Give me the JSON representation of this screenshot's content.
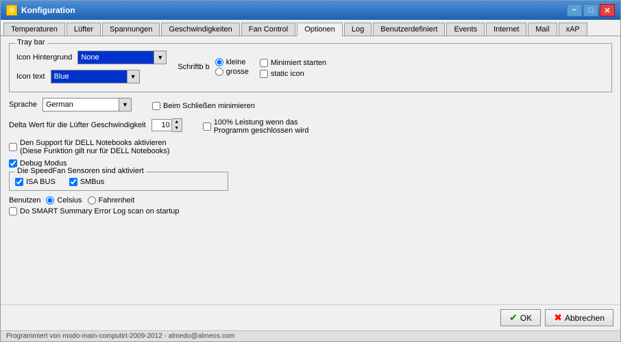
{
  "window": {
    "title": "Konfiguration",
    "icon": "⚙"
  },
  "titlebar": {
    "minimize": "−",
    "restore": "□",
    "close": "✕"
  },
  "tabs": [
    {
      "label": "Temperaturen",
      "active": false
    },
    {
      "label": "Lüfter",
      "active": false
    },
    {
      "label": "Spannungen",
      "active": false
    },
    {
      "label": "Geschwindigkeiten",
      "active": false
    },
    {
      "label": "Fan Control",
      "active": false
    },
    {
      "label": "Optionen",
      "active": true
    },
    {
      "label": "Log",
      "active": false
    },
    {
      "label": "Benutzerdefiniert",
      "active": false
    },
    {
      "label": "Events",
      "active": false
    },
    {
      "label": "Internet",
      "active": false
    },
    {
      "label": "Mail",
      "active": false
    },
    {
      "label": "xAP",
      "active": false
    }
  ],
  "tray_group": {
    "title": "Tray bar",
    "icon_hintergrund_label": "Icon Hintergrund",
    "icon_hintergrund_value": "None",
    "schriftb_label": "Schriftb b",
    "kleine_label": "kleine",
    "grosse_label": "grosse",
    "minimiert_label": "Minimiert starten",
    "static_label": "static icon",
    "icon_text_label": "Icon text",
    "icon_text_value": "Blue"
  },
  "sprache": {
    "label": "Sprache",
    "value": "German"
  },
  "beim_schliessen": {
    "label": "Beim Schließen minimieren"
  },
  "delta_wert": {
    "label": "Delta Wert für die Lüfter Geschwindigkeit",
    "value": "10"
  },
  "leistung": {
    "label": "100% Leistung wenn das",
    "label2": "Programm geschlossen wird"
  },
  "dell": {
    "label": "Den Support für DELL Notebooks aktivieren",
    "label2": "(Diese Funktion gilt nur für DELL Notebooks)"
  },
  "debug": {
    "label": "Debug Modus",
    "checked": true
  },
  "sensors_group": {
    "title": "Die SpeedFan Sensoren sind aktiviert",
    "isa_label": "ISA BUS",
    "smb_label": "SMBus"
  },
  "benutzen": {
    "label": "Benutzen",
    "celsius": "Celsius",
    "fahrenheit": "Fahrenheit"
  },
  "smart": {
    "label": "Do SMART Summary Error Log scan on startup"
  },
  "footer": {
    "ok_label": "OK",
    "cancel_label": "Abbrechen"
  },
  "statusbar": {
    "text": "Programmiert von modo-main-computirt-2009-2012 - almedo@almeos.com"
  }
}
